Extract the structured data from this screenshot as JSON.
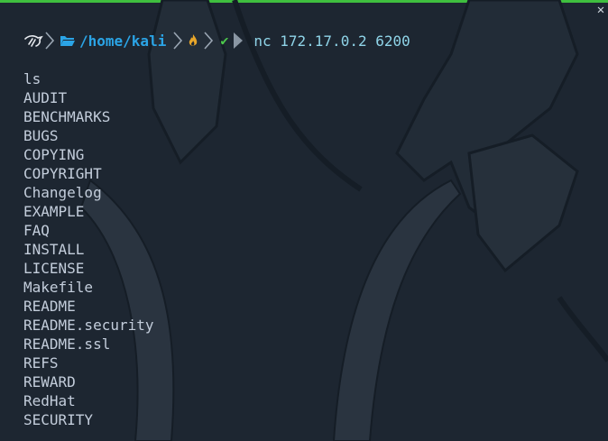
{
  "window": {
    "close_glyph": "✕"
  },
  "prompt": {
    "kali_icon": "kali-dragon-icon",
    "folder_icon": "folder-open-icon",
    "path": "/home/kali",
    "git_icon": "flame-icon",
    "status_icon": "check-icon",
    "status_glyph": "✔",
    "command": "nc 172.17.0.2 6200"
  },
  "output": {
    "lines": [
      "ls",
      "AUDIT",
      "BENCHMARKS",
      "BUGS",
      "COPYING",
      "COPYRIGHT",
      "Changelog",
      "EXAMPLE",
      "FAQ",
      "INSTALL",
      "LICENSE",
      "Makefile",
      "README",
      "README.security",
      "README.ssl",
      "REFS",
      "REWARD",
      "RedHat",
      "SECURITY"
    ]
  },
  "colors": {
    "background": "#1d2631",
    "top_border": "#3fbf3f",
    "path": "#2ba4e6",
    "command": "#8fd4e8",
    "output_text": "#c3cddb",
    "status_ok": "#4cc94c",
    "flame": "#e8a62a"
  }
}
